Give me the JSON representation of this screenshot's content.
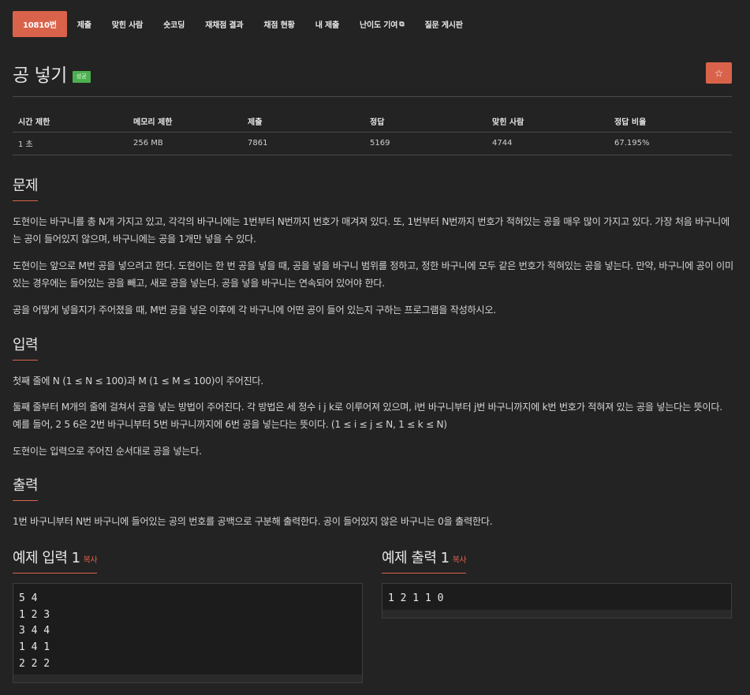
{
  "tabs": [
    {
      "label": "10810번",
      "active": true
    },
    {
      "label": "제출"
    },
    {
      "label": "맞힌 사람"
    },
    {
      "label": "숏코딩"
    },
    {
      "label": "재채점 결과"
    },
    {
      "label": "채점 현황"
    },
    {
      "label": "내 제출"
    },
    {
      "label": "난이도 기여"
    },
    {
      "label": "질문 게시판"
    }
  ],
  "problem": {
    "title": "공 넣기",
    "badge": "성공",
    "star": "☆"
  },
  "stats": {
    "headers": [
      "시간 제한",
      "메모리 제한",
      "제출",
      "정답",
      "맞힌 사람",
      "정답 비율"
    ],
    "values": [
      "1 초",
      "256 MB",
      "7861",
      "5169",
      "4744",
      "67.195%"
    ]
  },
  "sections": {
    "problem_title": "문제",
    "problem_p1": "도현이는 바구니를 총 N개 가지고 있고, 각각의 바구니에는 1번부터 N번까지 번호가 매겨져 있다. 또, 1번부터 N번까지 번호가 적혀있는 공을 매우 많이 가지고 있다. 가장 처음 바구니에는 공이 들어있지 않으며, 바구니에는 공을 1개만 넣을 수 있다.",
    "problem_p2": "도현이는 앞으로 M번 공을 넣으려고 한다. 도현이는 한 번 공을 넣을 때, 공을 넣을 바구니 범위를 정하고, 정한 바구니에 모두 같은 번호가 적혀있는 공을 넣는다. 만약, 바구니에 공이 이미 있는 경우에는 들어있는 공을 빼고, 새로 공을 넣는다. 공을 넣을 바구니는 연속되어 있어야 한다.",
    "problem_p3": "공을 어떻게 넣을지가 주어졌을 때, M번 공을 넣은 이후에 각 바구니에 어떤 공이 들어 있는지 구하는 프로그램을 작성하시오.",
    "input_title": "입력",
    "input_p1": "첫째 줄에 N (1 ≤ N ≤ 100)과 M (1 ≤ M ≤ 100)이 주어진다.",
    "input_p2": "둘째 줄부터 M개의 줄에 걸쳐서 공을 넣는 방법이 주어진다. 각 방법은 세 정수 i j k로 이루어져 있으며, i번 바구니부터 j번 바구니까지에 k번 번호가 적혀져 있는 공을 넣는다는 뜻이다. 예를 들어, 2 5 6은 2번 바구니부터 5번 바구니까지에 6번 공을 넣는다는 뜻이다. (1 ≤ i ≤ j ≤ N, 1 ≤ k ≤ N)",
    "input_p3": "도현이는 입력으로 주어진 순서대로 공을 넣는다.",
    "output_title": "출력",
    "output_p1": "1번 바구니부터 N번 바구니에 들어있는 공의 번호를 공백으로 구분해 출력한다. 공이 들어있지 않은 바구니는 0을 출력한다."
  },
  "samples": {
    "input_title": "예제 입력 1",
    "output_title": "예제 출력 1",
    "copy_label": "복사",
    "input_text": "5 4\n1 2 3\n3 4 4\n1 4 1\n2 2 2",
    "output_text": "1 2 1 1 0"
  }
}
